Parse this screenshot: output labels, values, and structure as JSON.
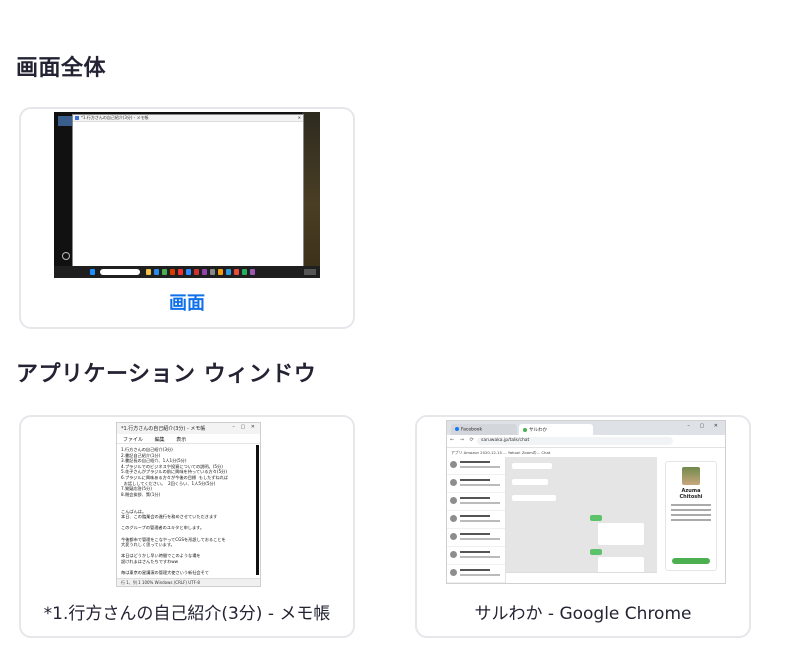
{
  "sections": {
    "screen_title": "画面全体",
    "app_title": "アプリケーション ウィンドウ"
  },
  "cards": {
    "screen": {
      "label": "画面",
      "selected": true,
      "thumb_window_title": "*1.行方さんの自己紹介(3分) - メモ帳"
    },
    "notepad": {
      "label": "*1.行方さんの自己紹介(3分) - メモ帳",
      "thumb": {
        "title": "*1.行方さんの自己紹介(3分) - メモ帳",
        "menu": [
          "ファイル",
          "編集",
          "表示"
        ],
        "body": "1.行方さんの自己紹介(3分)\n2.書記自己紹介(1分)\n3.書記長の自己紹介、1人1分(5分)\n4.プラジルでのビジネスや投資についての説明。(5分)\n5.花子さんがプラジルの前に興味を持っている方々(5分)\n6.プラジルに興味ある方々が今後の目標  もしたずねれば\n  お話ししてください。  2回くらい、1人5分(5分)\n7.質疑応答(5分)\n8.閉会挨拶、策(1分)\n\n\nこんばんは。\n本日、この臨業会の進行を務めさせていただきます\n\nこのグループの管理者のユキタと申します。\n\n今後都市で管理をこなやってCGSを形設しておることを\n大変うれしく思っています。\n\n本日はどうかし早い時間でこのような場を\n設けれまはさんたちですわww\n\n毎は東京の星講演の管理大使さいう新社会そて\n\n３４年前から融合事業を発進しています。",
        "status": "行 1、列 1    100%    Windows (CRLF)    UTF-8"
      }
    },
    "chrome": {
      "label": "サルわか - Google Chrome",
      "thumb": {
        "tab1": "Facebook",
        "tab2": "サルわか",
        "url": "saruwaka.jp/talk/chat",
        "bookmarks": "アプリ   Amazon   2020.12.15 ...   Yahoo!   Zoomの...   Chat",
        "profile_name": "Azuma\nChitoshi"
      }
    }
  }
}
